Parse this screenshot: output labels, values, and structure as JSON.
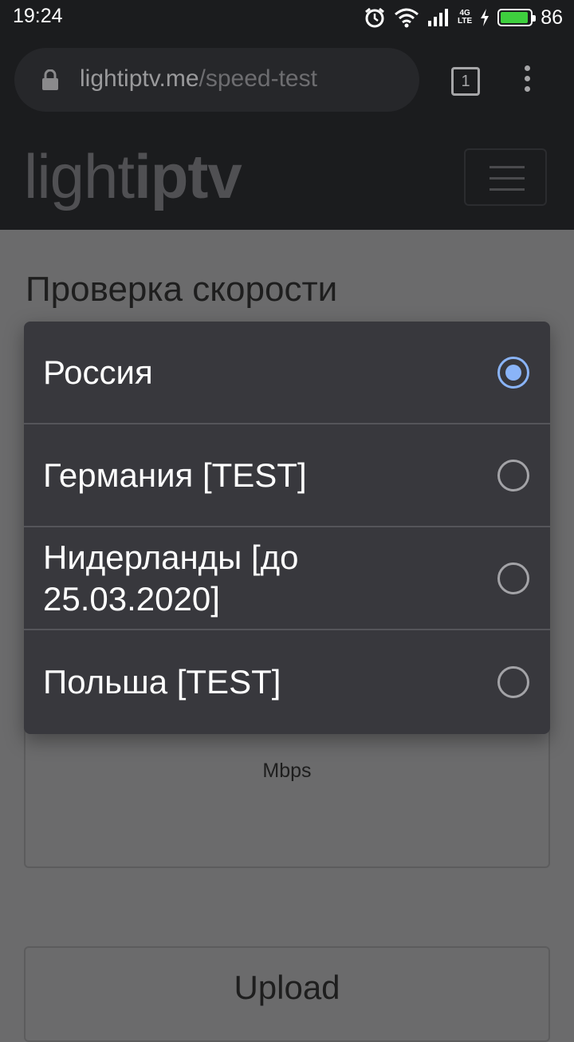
{
  "status_bar": {
    "time": "19:24",
    "network": "4G",
    "network_sub": "LTE",
    "battery": "86"
  },
  "browser": {
    "url_host": "lightiptv.me",
    "url_path": "/speed-test",
    "tab_count": "1"
  },
  "site": {
    "logo_light": "light",
    "logo_bold": "iptv"
  },
  "page": {
    "title": "Проверка скорости",
    "unit": "Mbps",
    "upload_label": "Upload"
  },
  "dialog": {
    "options": [
      {
        "label": "Россия",
        "checked": true
      },
      {
        "label": "Германия [TEST]",
        "checked": false
      },
      {
        "label": "Нидерланды [до 25.03.2020]",
        "checked": false
      },
      {
        "label": "Польша [TEST]",
        "checked": false
      }
    ]
  },
  "colors": {
    "accent": "#8ab4f8",
    "battery": "#3ecf3e",
    "dialog_bg": "#38383d"
  }
}
